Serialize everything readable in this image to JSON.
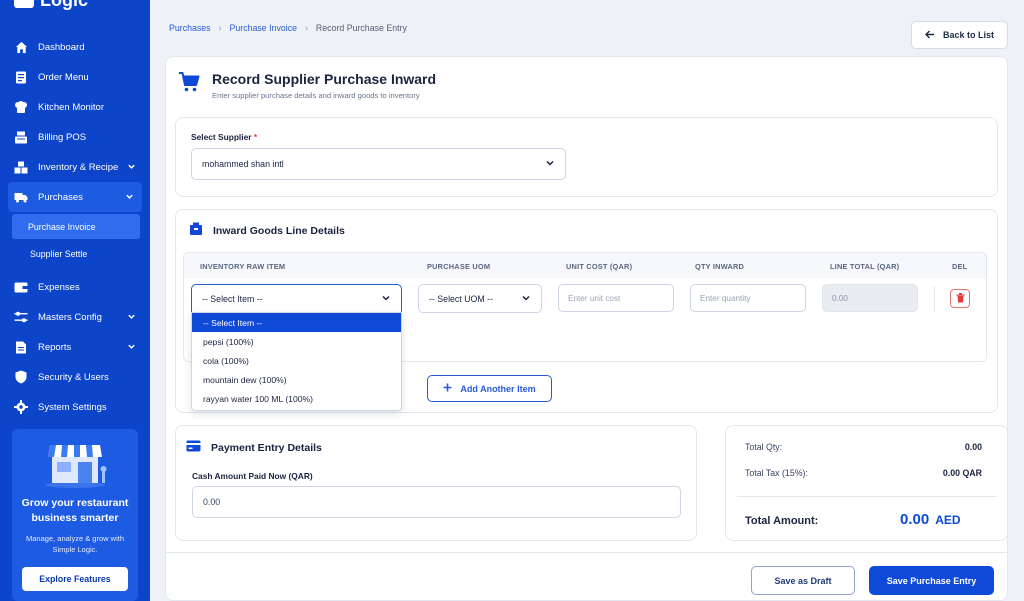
{
  "app": {
    "logo_text": "Logic"
  },
  "colors": {
    "sidebar": "#0c45c9",
    "accent": "#0e49d8",
    "danger": "#e23b3b"
  },
  "sidebar": {
    "items": [
      {
        "label": "Dashboard",
        "icon": "home-icon"
      },
      {
        "label": "Order Menu",
        "icon": "menu-icon"
      },
      {
        "label": "Kitchen Monitor",
        "icon": "chef-icon"
      },
      {
        "label": "Billing POS",
        "icon": "register-icon"
      },
      {
        "label": "Inventory & Recipe",
        "icon": "boxes-icon"
      },
      {
        "label": "Purchases",
        "icon": "truck-icon"
      },
      {
        "label": "Expenses",
        "icon": "wallet-icon"
      },
      {
        "label": "Masters Config",
        "icon": "sliders-icon"
      },
      {
        "label": "Reports",
        "icon": "report-icon"
      },
      {
        "label": "Security & Users",
        "icon": "shield-icon"
      },
      {
        "label": "System Settings",
        "icon": "gear-icon"
      }
    ],
    "purchases_sub": [
      {
        "label": "Purchase Invoice"
      },
      {
        "label": "Supplier Settle"
      }
    ],
    "promo": {
      "title": "Grow your restaurant business smarter",
      "desc": "Manage, analyze & grow with Simple Logic.",
      "button": "Explore Features"
    }
  },
  "breadcrumb": {
    "a": "Purchases",
    "b": "Purchase Invoice",
    "current": "Record Purchase Entry"
  },
  "back_button": "Back to List",
  "header": {
    "title": "Record Supplier Purchase Inward",
    "subtitle": "Enter supplier purchase details and inward goods to inventory"
  },
  "supplier": {
    "label": "Select Supplier",
    "required_mark": "*",
    "value": "mohammed shan intl"
  },
  "lines": {
    "title": "Inward Goods Line Details",
    "columns": [
      "INVENTORY RAW ITEM",
      "PURCHASE UOM",
      "UNIT COST (QAR)",
      "QTY INWARD",
      "LINE TOTAL (QAR)",
      "DEL"
    ],
    "item_select": "-- Select Item --",
    "uom_select": "-- Select UOM --",
    "unit_cost_placeholder": "Enter unit cost",
    "qty_placeholder": "Enter quantity",
    "line_total": "0.00",
    "dropdown_options": [
      "-- Select Item --",
      "pepsi (100%)",
      "cola (100%)",
      "mountain dew (100%)",
      "rayyan water 100 ML (100%)"
    ],
    "add_button": "Add Another Item"
  },
  "payment": {
    "title": "Payment Entry Details",
    "label": "Cash Amount Paid Now (QAR)",
    "value": "0.00"
  },
  "summary": {
    "qty_label": "Total Qty:",
    "qty_value": "0.00",
    "tax_label": "Total Tax (15%):",
    "tax_value": "0.00 QAR",
    "total_label": "Total Amount:",
    "total_value": "0.00",
    "total_currency": "AED"
  },
  "footer": {
    "draft": "Save as Draft",
    "save": "Save Purchase Entry"
  }
}
